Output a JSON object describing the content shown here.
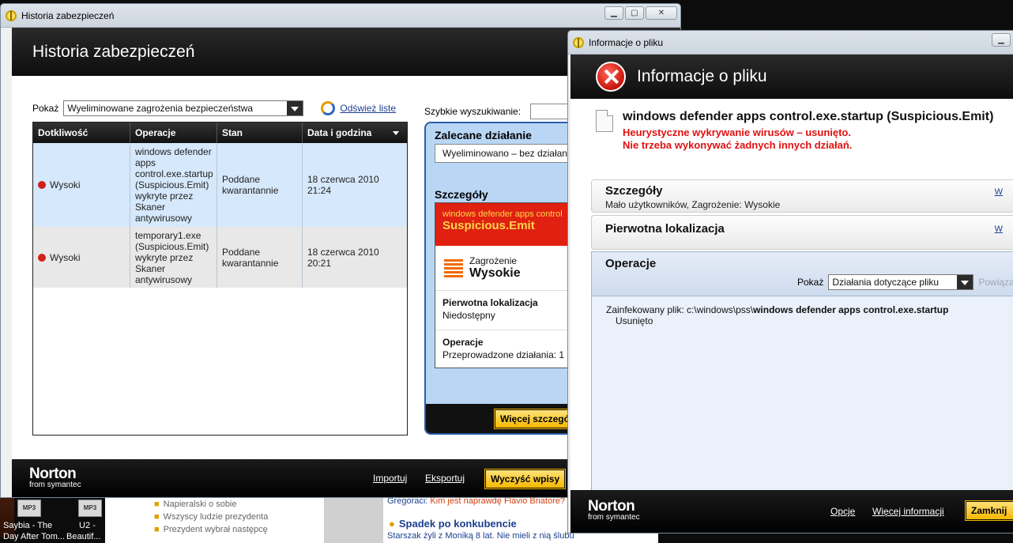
{
  "desktop": {
    "tile1_label": "MP3",
    "tile2_label": "MP3",
    "item1_line1": "Saybia - The",
    "item1_line2": "Day After Tom...",
    "item2_line1": "U2 -",
    "item2_line2": "Beautif...",
    "bg_lines": [
      "Napieralski o sobie",
      "Wszyscy ludzie prezydenta",
      "Prezydent wybrał następcę"
    ],
    "bg_news_prefix": "Gregoraci:",
    "bg_news_text": "Kim jest naprawdę Flavio Briatore?",
    "bg_news_title": "Spadek po konkubencie",
    "bg_news_sub": "Starszak żyli z Moniką 8 lat. Nie mieli z nią ślubu"
  },
  "win1": {
    "title": "Historia zabezpieczeń",
    "header": "Historia zabezpieczeń",
    "show_label": "Pokaż",
    "show_value": "Wyeliminowane zagrożenia bezpieczeństwa",
    "refresh": "Odśwież liste",
    "quick_search": "Szybkie wyszukiwanie:",
    "columns": [
      "Dotkliwość",
      "Operacje",
      "Stan",
      "Data i godzina"
    ],
    "rows": [
      {
        "severity": "Wysoki",
        "operation": "windows defender apps control.exe.startup (Suspicious.Emit) wykryte przez Skaner antywirusowy",
        "status": "Poddane kwarantannie",
        "date": "18 czerwca 2010 21:24"
      },
      {
        "severity": "Wysoki",
        "operation": "temporary1.exe (Suspicious.Emit) wykryte przez Skaner antywirusowy",
        "status": "Poddane kwarantannie",
        "date": "18 czerwca 2010 20:21"
      }
    ],
    "recommended_title": "Zalecane działanie",
    "recommended_value": "Wyeliminowano – bez działania",
    "details_title": "Szczegóły",
    "threat_small": "windows defender apps control",
    "threat_big": "Suspicious.Emit",
    "threat_label": "Zagrożenie",
    "threat_value": "Wysokie",
    "orig_loc_title": "Pierwotna lokalizacja",
    "orig_loc_value": "Niedostępny",
    "ops_title": "Operacje",
    "ops_value": "Przeprowadzone działania: 1",
    "more_details": "Więcej szczegółów",
    "import": "Importuj",
    "export": "Eksportuj",
    "clear": "Wyczyść wpisy",
    "brand": "Norton",
    "brand_sub": "from symantec"
  },
  "win2": {
    "title": "Informacje o pliku",
    "header": "Informacje o pliku",
    "file_name": "windows defender apps control.exe.startup (Suspicious.Emit)",
    "red1": "Heurystyczne wykrywanie wirusów – usunięto.",
    "red2": "Nie trzeba wykonywać żadnych innych działań.",
    "details_title": "Szczegóły",
    "details_sub": "Mało użytkowników,  Zagrożenie: Wysokie",
    "link_w": "W",
    "orig_title": "Pierwotna lokalizacja",
    "ops_title": "Operacje",
    "show_label": "Pokaż",
    "show_value": "Działania dotyczące pliku",
    "related": "Powiązane",
    "infected_label": "Zainfekowany plik: c:\\windows\\pss\\",
    "infected_file": "windows defender apps control.exe.startup",
    "removed": "Usunięto",
    "options": "Opcje",
    "more_info": "Więcej informacji",
    "close": "Zamknij",
    "brand": "Norton",
    "brand_sub": "from symantec"
  }
}
